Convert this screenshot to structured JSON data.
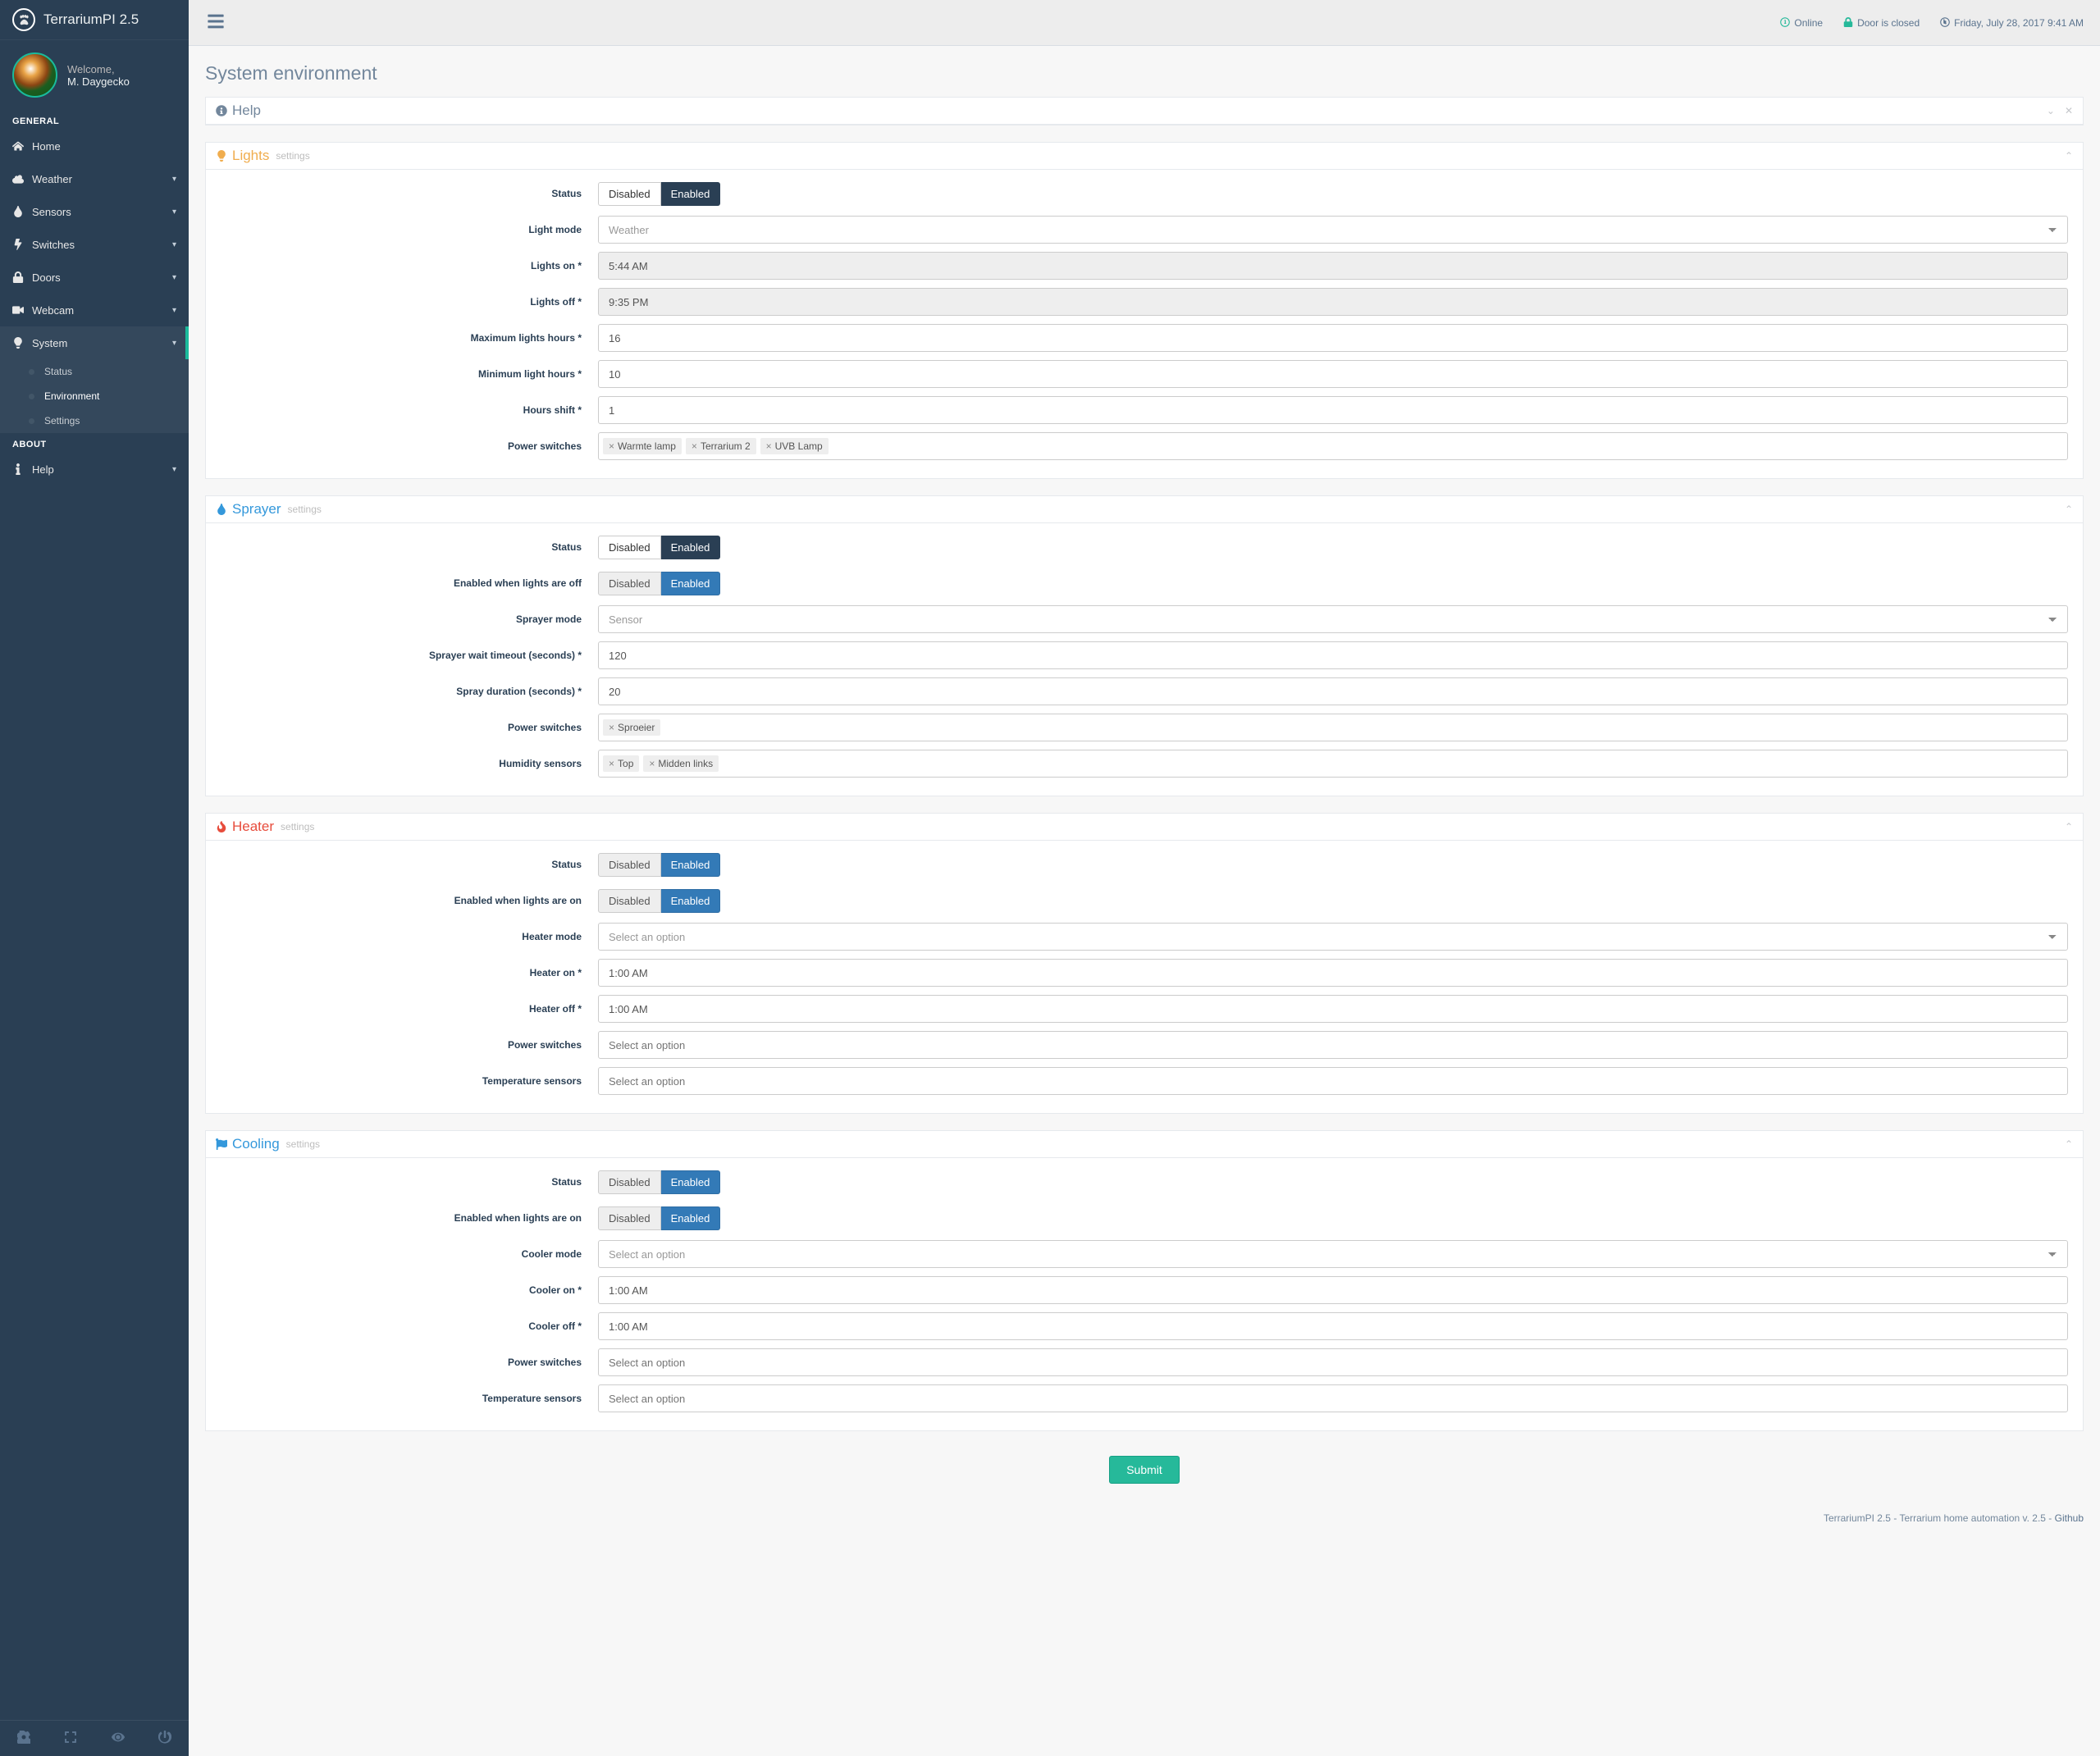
{
  "app": {
    "title": "TerrariumPI 2.5"
  },
  "profile": {
    "welcome": "Welcome,",
    "name": "M. Daygecko"
  },
  "topbar": {
    "online": "Online",
    "door": "Door is closed",
    "datetime": "Friday, July 28, 2017 9:41 AM"
  },
  "menu": {
    "section_general": "GENERAL",
    "section_about": "ABOUT",
    "home": "Home",
    "weather": "Weather",
    "sensors": "Sensors",
    "switches": "Switches",
    "doors": "Doors",
    "webcam": "Webcam",
    "system": "System",
    "help": "Help",
    "sub_status": "Status",
    "sub_environment": "Environment",
    "sub_settings": "Settings"
  },
  "page": {
    "title": "System environment",
    "help": "Help"
  },
  "labels": {
    "settings": "settings",
    "status": "Status",
    "disabled": "Disabled",
    "enabled": "Enabled",
    "select_option": "Select an option",
    "power_switches": "Power switches",
    "temperature_sensors": "Temperature sensors",
    "enabled_when_lights_off": "Enabled when lights are off",
    "enabled_when_lights_on": "Enabled when lights are on"
  },
  "lights": {
    "title": "Lights",
    "mode_label": "Light mode",
    "mode_value": "Weather",
    "on_label": "Lights on *",
    "on_value": "5:44 AM",
    "off_label": "Lights off *",
    "off_value": "9:35 PM",
    "max_hours_label": "Maximum lights hours *",
    "max_hours_value": "16",
    "min_hours_label": "Minimum light hours *",
    "min_hours_value": "10",
    "shift_label": "Hours shift *",
    "shift_value": "1",
    "tags": [
      "Warmte lamp",
      "Terrarium 2",
      "UVB Lamp"
    ]
  },
  "sprayer": {
    "title": "Sprayer",
    "mode_label": "Sprayer mode",
    "mode_value": "Sensor",
    "wait_label": "Sprayer wait timeout (seconds) *",
    "wait_value": "120",
    "duration_label": "Spray duration (seconds) *",
    "duration_value": "20",
    "tags": [
      "Sproeier"
    ],
    "humidity_label": "Humidity sensors",
    "humidity_tags": [
      "Top",
      "Midden links"
    ]
  },
  "heater": {
    "title": "Heater",
    "mode_label": "Heater mode",
    "on_label": "Heater on *",
    "on_value": "1:00 AM",
    "off_label": "Heater off *",
    "off_value": "1:00 AM"
  },
  "cooling": {
    "title": "Cooling",
    "mode_label": "Cooler mode",
    "on_label": "Cooler on *",
    "on_value": "1:00 AM",
    "off_label": "Cooler off *",
    "off_value": "1:00 AM"
  },
  "submit": "Submit",
  "footer": {
    "left": "TerrariumPI 2.5",
    "mid": "Terrarium home automation v. 2.5",
    "right": "Github"
  }
}
